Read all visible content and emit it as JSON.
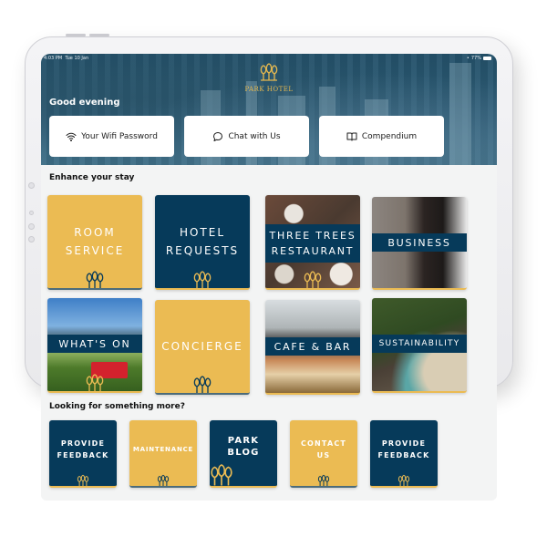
{
  "status_bar": {
    "time": "4:03 PM",
    "date": "Tue 10 Jan",
    "battery": "77%"
  },
  "brand": {
    "name": "PARK HOTEL",
    "logo_icon": "three-trees-icon"
  },
  "header": {
    "greeting": "Good evening"
  },
  "quick_actions": [
    {
      "label": "Your Wifi Password",
      "icon": "wifi-icon"
    },
    {
      "label": "Chat with Us",
      "icon": "chat-bubble-icon"
    },
    {
      "label": "Compendium",
      "icon": "book-icon"
    }
  ],
  "sections": {
    "enhance": {
      "title": "Enhance your stay"
    },
    "more": {
      "title": "Looking for something more?"
    }
  },
  "enhance_tiles": [
    {
      "label_line1": "ROOM",
      "label_line2": "SERVICE",
      "style": "gold"
    },
    {
      "label_line1": "HOTEL",
      "label_line2": "REQUESTS",
      "style": "navy"
    },
    {
      "label_line1": "THREE TREES",
      "label_line2": "RESTAURANT",
      "style": "photo"
    },
    {
      "label_line1": "BUSINESS",
      "style": "photo"
    },
    {
      "label_line1": "WHAT'S ON",
      "style": "photo"
    },
    {
      "label_line1": "CONCIERGE",
      "style": "gold"
    },
    {
      "label_line1": "CAFE & BAR",
      "style": "photo"
    },
    {
      "label_line1": "SUSTAINABILITY",
      "style": "photo"
    }
  ],
  "more_tiles": [
    {
      "label_line1": "PROVIDE",
      "label_line2": "FEEDBACK",
      "style": "navy"
    },
    {
      "label_line1": "MAINTENANCE",
      "style": "gold"
    },
    {
      "label_line1": "PARK",
      "label_line2": "BLOG",
      "style": "navy"
    },
    {
      "label_line1": "CONTACT",
      "label_line2": "US",
      "style": "gold"
    },
    {
      "label_line1": "PROVIDE",
      "label_line2": "FEEDBACK",
      "style": "navy"
    }
  ],
  "colors": {
    "gold": "#ebbb53",
    "navy": "#063a5a",
    "background": "#f3f4f4"
  }
}
